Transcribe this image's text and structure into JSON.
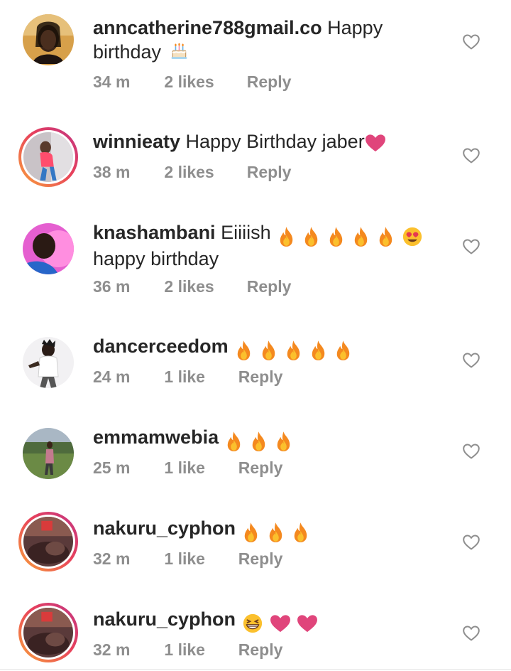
{
  "comments": [
    {
      "username": "anncatherine788gmail.co",
      "text_line1": "Happy",
      "text_line2": "birthday",
      "time": "34 m",
      "likes": "2 likes",
      "reply": "Reply",
      "emoji": [
        "birthday-cake"
      ],
      "story_ring": false
    },
    {
      "username": "winnieaty",
      "text_line1": "Happy Birthday jaber",
      "time": "38 m",
      "likes": "2 likes",
      "reply": "Reply",
      "emoji": [
        "pink-heart"
      ],
      "story_ring": true
    },
    {
      "username": "knashambani",
      "text_line1": "Eiiiish",
      "text_line2": "happy birthday",
      "time": "36 m",
      "likes": "2 likes",
      "reply": "Reply",
      "emoji": [
        "fire",
        "fire",
        "fire",
        "fire",
        "fire",
        "heart-eyes"
      ],
      "story_ring": false
    },
    {
      "username": "dancerceedom",
      "time": "24 m",
      "likes": "1 like",
      "reply": "Reply",
      "emoji": [
        "fire",
        "fire",
        "fire",
        "fire",
        "fire"
      ],
      "story_ring": false
    },
    {
      "username": "emmamwebia",
      "time": "25 m",
      "likes": "1 like",
      "reply": "Reply",
      "emoji": [
        "fire",
        "fire",
        "fire"
      ],
      "story_ring": false
    },
    {
      "username": "nakuru_cyphon",
      "time": "32 m",
      "likes": "1 like",
      "reply": "Reply",
      "emoji": [
        "fire",
        "fire",
        "fire"
      ],
      "story_ring": true
    },
    {
      "username": "nakuru_cyphon",
      "time": "32 m",
      "likes": "1 like",
      "reply": "Reply",
      "emoji": [
        "grinning-squint",
        "pink-heart",
        "pink-heart"
      ],
      "story_ring": true
    }
  ],
  "icons": {
    "like": "heart-outline-icon"
  },
  "colors": {
    "username": "#262626",
    "meta": "#8e8e8e",
    "heart_emoji": "#e0457b",
    "fire": "#f4891f",
    "story_ring_start": "#f9a33b",
    "story_ring_end": "#c13584"
  }
}
